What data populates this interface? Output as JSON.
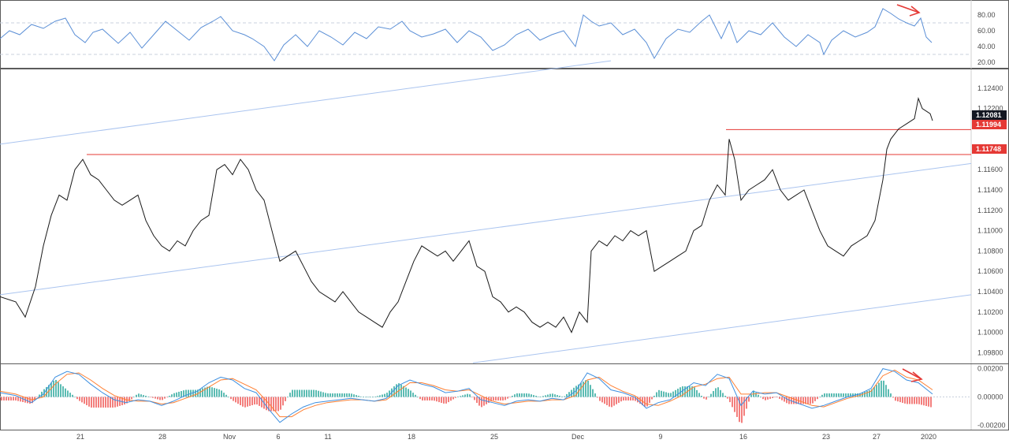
{
  "chart_data": [
    {
      "type": "line",
      "name": "rsi-pane",
      "ylim": [
        15,
        95
      ],
      "y_ticks": [
        "80.00",
        "60.00",
        "40.00",
        "20.00"
      ],
      "y_tick_values": [
        80,
        60,
        40,
        20
      ],
      "dashed_levels": [
        70,
        30
      ],
      "series": [
        {
          "x": [
            0,
            12,
            25,
            40,
            55,
            70,
            83,
            95,
            108,
            118,
            130,
            150,
            165,
            180,
            195,
            210,
            225,
            240,
            255,
            270,
            280,
            295,
            310,
            320,
            335,
            348,
            360,
            375,
            390,
            405,
            420,
            435,
            450,
            465,
            480,
            495,
            510,
            520,
            535,
            550,
            565,
            580,
            595,
            610,
            625,
            640,
            655,
            670,
            685,
            700,
            715,
            730,
            740,
            750,
            760,
            775,
            790,
            805,
            820,
            830,
            845,
            860,
            875,
            890,
            900,
            915,
            925,
            935,
            950,
            965,
            980,
            995,
            1010,
            1025,
            1040,
            1045,
            1055,
            1070,
            1085,
            1100,
            1110,
            1120,
            1130,
            1140,
            1150,
            1160,
            1168,
            1175,
            1182
          ],
          "values": [
            50,
            60,
            55,
            68,
            63,
            72,
            76,
            55,
            45,
            58,
            62,
            44,
            58,
            38,
            55,
            72,
            60,
            48,
            64,
            72,
            78,
            60,
            55,
            50,
            40,
            22,
            42,
            55,
            40,
            60,
            52,
            42,
            58,
            50,
            65,
            62,
            72,
            60,
            52,
            56,
            62,
            45,
            60,
            52,
            35,
            42,
            55,
            62,
            48,
            55,
            60,
            40,
            80,
            72,
            66,
            70,
            55,
            62,
            45,
            25,
            50,
            62,
            58,
            72,
            80,
            50,
            72,
            45,
            60,
            55,
            70,
            52,
            40,
            55,
            45,
            30,
            48,
            60,
            52,
            58,
            65,
            88,
            82,
            75,
            70,
            66,
            76,
            52,
            45
          ]
        }
      ],
      "annotation": "red arrow pointing down-right near recent RSI peak"
    },
    {
      "type": "line",
      "name": "price-pane",
      "ylim": [
        1.0971,
        1.1257
      ],
      "y_ticks": [
        "1.12400",
        "1.12200",
        "1.11800",
        "1.11600",
        "1.11400",
        "1.11200",
        "1.11000",
        "1.10800",
        "1.10600",
        "1.10400",
        "1.10200",
        "1.10000",
        "1.09800"
      ],
      "y_tick_values": [
        1.124,
        1.122,
        1.118,
        1.116,
        1.114,
        1.112,
        1.11,
        1.108,
        1.106,
        1.104,
        1.102,
        1.1,
        1.098
      ],
      "x_ticks": [
        "21",
        "28",
        "Nov",
        "6",
        "11",
        "18",
        "25",
        "Dec",
        "9",
        "16",
        "23",
        "27",
        "2020"
      ],
      "x_tick_positions": [
        102,
        206,
        291,
        353,
        416,
        522,
        627,
        733,
        838,
        943,
        1048,
        1112,
        1178
      ],
      "price_tags": [
        {
          "label": "1.12081",
          "value": 1.12081,
          "color": "#131722"
        },
        {
          "label": "1.11994",
          "value": 1.11994,
          "color": "#e53935"
        },
        {
          "label": "1.11748",
          "value": 1.11748,
          "color": "#e53935"
        }
      ],
      "horizontal_levels": [
        {
          "value": 1.11994,
          "from_x": 921,
          "color": "#e53935"
        },
        {
          "value": 1.11748,
          "from_x": 110,
          "color": "#e53935"
        }
      ],
      "series": [
        {
          "x": [
            0,
            20,
            32,
            45,
            55,
            65,
            75,
            85,
            95,
            105,
            115,
            125,
            135,
            145,
            155,
            165,
            175,
            185,
            195,
            205,
            215,
            225,
            235,
            245,
            255,
            265,
            275,
            285,
            295,
            305,
            315,
            325,
            335,
            345,
            355,
            365,
            375,
            385,
            395,
            405,
            415,
            425,
            435,
            445,
            455,
            465,
            475,
            485,
            495,
            505,
            515,
            525,
            535,
            545,
            555,
            565,
            575,
            585,
            595,
            605,
            615,
            625,
            635,
            645,
            655,
            665,
            675,
            685,
            695,
            705,
            715,
            725,
            735,
            745,
            750,
            760,
            770,
            780,
            790,
            800,
            810,
            820,
            830,
            840,
            850,
            860,
            870,
            880,
            890,
            900,
            910,
            920,
            925,
            932,
            940,
            950,
            960,
            970,
            980,
            990,
            1000,
            1010,
            1020,
            1030,
            1040,
            1050,
            1060,
            1070,
            1080,
            1090,
            1100,
            1110,
            1120,
            1125,
            1130,
            1140,
            1150,
            1160,
            1165,
            1170,
            1180,
            1183
          ],
          "values": [
            1.1035,
            1.103,
            1.1015,
            1.1045,
            1.1085,
            1.1115,
            1.1135,
            1.113,
            1.116,
            1.117,
            1.1155,
            1.115,
            1.114,
            1.113,
            1.1125,
            1.113,
            1.1135,
            1.111,
            1.1095,
            1.1085,
            1.108,
            1.109,
            1.1085,
            1.11,
            1.111,
            1.1115,
            1.116,
            1.1165,
            1.1155,
            1.117,
            1.116,
            1.114,
            1.113,
            1.11,
            1.107,
            1.1075,
            1.108,
            1.1065,
            1.105,
            1.104,
            1.1035,
            1.103,
            1.104,
            1.103,
            1.102,
            1.1015,
            1.101,
            1.1005,
            1.102,
            1.103,
            1.105,
            1.107,
            1.1085,
            1.108,
            1.1075,
            1.108,
            1.107,
            1.108,
            1.109,
            1.1065,
            1.106,
            1.1035,
            1.103,
            1.102,
            1.1025,
            1.102,
            1.101,
            1.1005,
            1.101,
            1.1005,
            1.1015,
            1.1,
            1.102,
            1.101,
            1.108,
            1.109,
            1.1085,
            1.1095,
            1.109,
            1.11,
            1.1095,
            1.11,
            1.106,
            1.1065,
            1.107,
            1.1075,
            1.108,
            1.11,
            1.1105,
            1.113,
            1.1145,
            1.1135,
            1.119,
            1.117,
            1.113,
            1.114,
            1.1145,
            1.115,
            1.116,
            1.114,
            1.113,
            1.1135,
            1.114,
            1.112,
            1.11,
            1.1085,
            1.108,
            1.1075,
            1.1085,
            1.109,
            1.1095,
            1.111,
            1.115,
            1.118,
            1.119,
            1.12,
            1.1205,
            1.121,
            1.123,
            1.122,
            1.1215,
            1.12081
          ]
        }
      ],
      "channel_lines": [
        {
          "x": [
            0,
            775
          ],
          "values": [
            1.1185,
            1.1267
          ]
        },
        {
          "x": [
            0,
            1232
          ],
          "values": [
            1.1037,
            1.1166
          ]
        },
        {
          "x": [
            600,
            1232
          ],
          "values": [
            1.097,
            1.1037
          ]
        }
      ]
    },
    {
      "type": "bar",
      "name": "macd-pane",
      "ylim": [
        -0.0022,
        0.0022
      ],
      "y_ticks": [
        "0.00200",
        "0.00000",
        "-0.00200"
      ],
      "y_tick_values": [
        0.002,
        0.0,
        -0.002
      ],
      "series": [
        {
          "name": "macd",
          "x": [
            0,
            20,
            40,
            55,
            70,
            85,
            100,
            115,
            130,
            145,
            160,
            175,
            190,
            205,
            220,
            235,
            250,
            265,
            280,
            295,
            310,
            325,
            340,
            355,
            370,
            385,
            400,
            415,
            430,
            445,
            460,
            475,
            490,
            505,
            520,
            535,
            550,
            565,
            580,
            595,
            610,
            625,
            640,
            655,
            670,
            685,
            700,
            715,
            730,
            745,
            760,
            775,
            790,
            805,
            820,
            835,
            850,
            865,
            880,
            895,
            910,
            925,
            940,
            955,
            970,
            985,
            1000,
            1015,
            1030,
            1045,
            1060,
            1075,
            1090,
            1105,
            1120,
            1135,
            1150,
            1165,
            1183
          ],
          "values": [
            0.0003,
            0.0001,
            -0.0004,
            0.0002,
            0.0014,
            0.0018,
            0.0016,
            0.0009,
            0.0003,
            -0.0002,
            -0.0004,
            -0.0002,
            -0.0003,
            -0.0006,
            -0.0003,
            0.0001,
            0.0004,
            0.001,
            0.0014,
            0.0012,
            0.0006,
            0.0003,
            -0.0008,
            -0.0018,
            -0.0012,
            -0.0007,
            -0.0004,
            -0.0003,
            -0.0002,
            -0.0001,
            -0.0002,
            -0.0003,
            -0.0001,
            0.0008,
            0.0012,
            0.0009,
            0.0007,
            0.0003,
            0.0004,
            0.0006,
            -0.0002,
            -0.0004,
            -0.0006,
            -0.0003,
            -0.0002,
            -0.0003,
            -0.0001,
            -0.0002,
            0.0004,
            0.0017,
            0.0013,
            0.0005,
            0.0003,
            0.0,
            -0.0008,
            -0.0004,
            -0.0002,
            0.0004,
            0.001,
            0.0008,
            0.0016,
            0.0013,
            -0.0006,
            0.0004,
            0.0002,
            0.0003,
            -0.0002,
            -0.0005,
            -0.0008,
            -0.0006,
            -0.0003,
            0.0,
            0.0002,
            0.0006,
            0.002,
            0.0018,
            0.0012,
            0.001,
            0.0002
          ]
        },
        {
          "name": "signal",
          "x": [
            0,
            20,
            40,
            55,
            70,
            85,
            100,
            115,
            130,
            145,
            160,
            175,
            190,
            205,
            220,
            235,
            250,
            265,
            280,
            295,
            310,
            325,
            340,
            355,
            370,
            385,
            400,
            415,
            430,
            445,
            460,
            475,
            490,
            505,
            520,
            535,
            550,
            565,
            580,
            595,
            610,
            625,
            640,
            655,
            670,
            685,
            700,
            715,
            730,
            745,
            760,
            775,
            790,
            805,
            820,
            835,
            850,
            865,
            880,
            895,
            910,
            925,
            940,
            955,
            970,
            985,
            1000,
            1015,
            1030,
            1045,
            1060,
            1075,
            1090,
            1105,
            1120,
            1135,
            1150,
            1165,
            1183
          ],
          "values": [
            0.0004,
            0.0002,
            -0.0002,
            0.0,
            0.0009,
            0.0016,
            0.0017,
            0.0012,
            0.0006,
            0.0001,
            -0.0002,
            -0.0003,
            -0.0003,
            -0.0005,
            -0.0004,
            -0.0001,
            0.0002,
            0.0007,
            0.0012,
            0.0013,
            0.0009,
            0.0005,
            -0.0004,
            -0.0014,
            -0.0014,
            -0.0009,
            -0.0006,
            -0.0004,
            -0.0003,
            -0.0002,
            -0.0002,
            -0.0003,
            -0.0002,
            0.0004,
            0.001,
            0.001,
            0.0008,
            0.0005,
            0.0004,
            0.0005,
            0.0001,
            -0.0003,
            -0.0005,
            -0.0004,
            -0.0003,
            -0.0003,
            -0.0002,
            -0.0002,
            0.0001,
            0.0012,
            0.0014,
            0.0008,
            0.0004,
            0.0001,
            -0.0005,
            -0.0006,
            -0.0003,
            0.0001,
            0.0007,
            0.0009,
            0.0013,
            0.0014,
            0.0002,
            0.0002,
            0.0003,
            0.0003,
            0.0,
            -0.0003,
            -0.0006,
            -0.0007,
            -0.0004,
            -0.0001,
            0.0001,
            0.0004,
            0.0015,
            0.0019,
            0.0014,
            0.0012,
            0.0005
          ]
        }
      ],
      "annotation": "red arrow pointing down-right near recent MACD peak"
    }
  ],
  "colors": {
    "rsi_line": "#5b8fd6",
    "price": "#1a1a1a",
    "channel": "#aac4ef",
    "level": "#e53935",
    "macd_line": "#3d8fe0",
    "signal_line": "#ff7f32",
    "hist_up": "#26a69a",
    "hist_down": "#ef5350",
    "grid_dash": "#c8d0dc",
    "border": "#5b5b5b"
  }
}
